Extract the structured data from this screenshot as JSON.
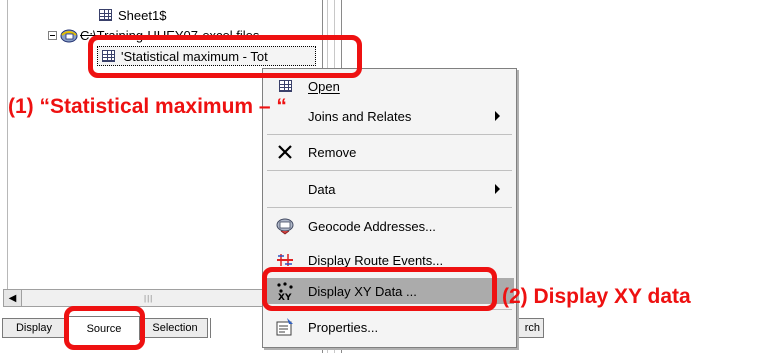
{
  "tree": {
    "sheet_item": "Sheet1$",
    "folder_item": "C:\\Training-HUEY07-excel files",
    "selected_item": "'Statistical maximum - Tot"
  },
  "menu": {
    "items": [
      {
        "label": "Open",
        "icon": "table-icon",
        "submenu": false
      },
      {
        "label": "Joins and Relates",
        "icon": "",
        "submenu": true
      },
      {
        "label": "Remove",
        "icon": "remove-x-icon",
        "submenu": false
      },
      {
        "label": "Data",
        "icon": "",
        "submenu": true
      },
      {
        "label": "Geocode Addresses...",
        "icon": "geocode-icon",
        "submenu": false
      },
      {
        "label": "Display Route Events...",
        "icon": "route-events-icon",
        "submenu": false
      },
      {
        "label": "Display XY Data ...",
        "icon": "xy-data-icon",
        "submenu": false
      },
      {
        "label": "Properties...",
        "icon": "properties-icon",
        "submenu": false
      }
    ]
  },
  "tabs": {
    "display": "Display",
    "source": "Source",
    "selection": "Selection",
    "search_partial": "rch"
  },
  "callouts": {
    "step1": "(1)  “Statistical maximum – “",
    "step2": "(2) Display XY data"
  },
  "colors": {
    "annotation_red": "#ee1111",
    "menu_highlight": "#ababab",
    "menu_background": "#f4f4f4"
  }
}
